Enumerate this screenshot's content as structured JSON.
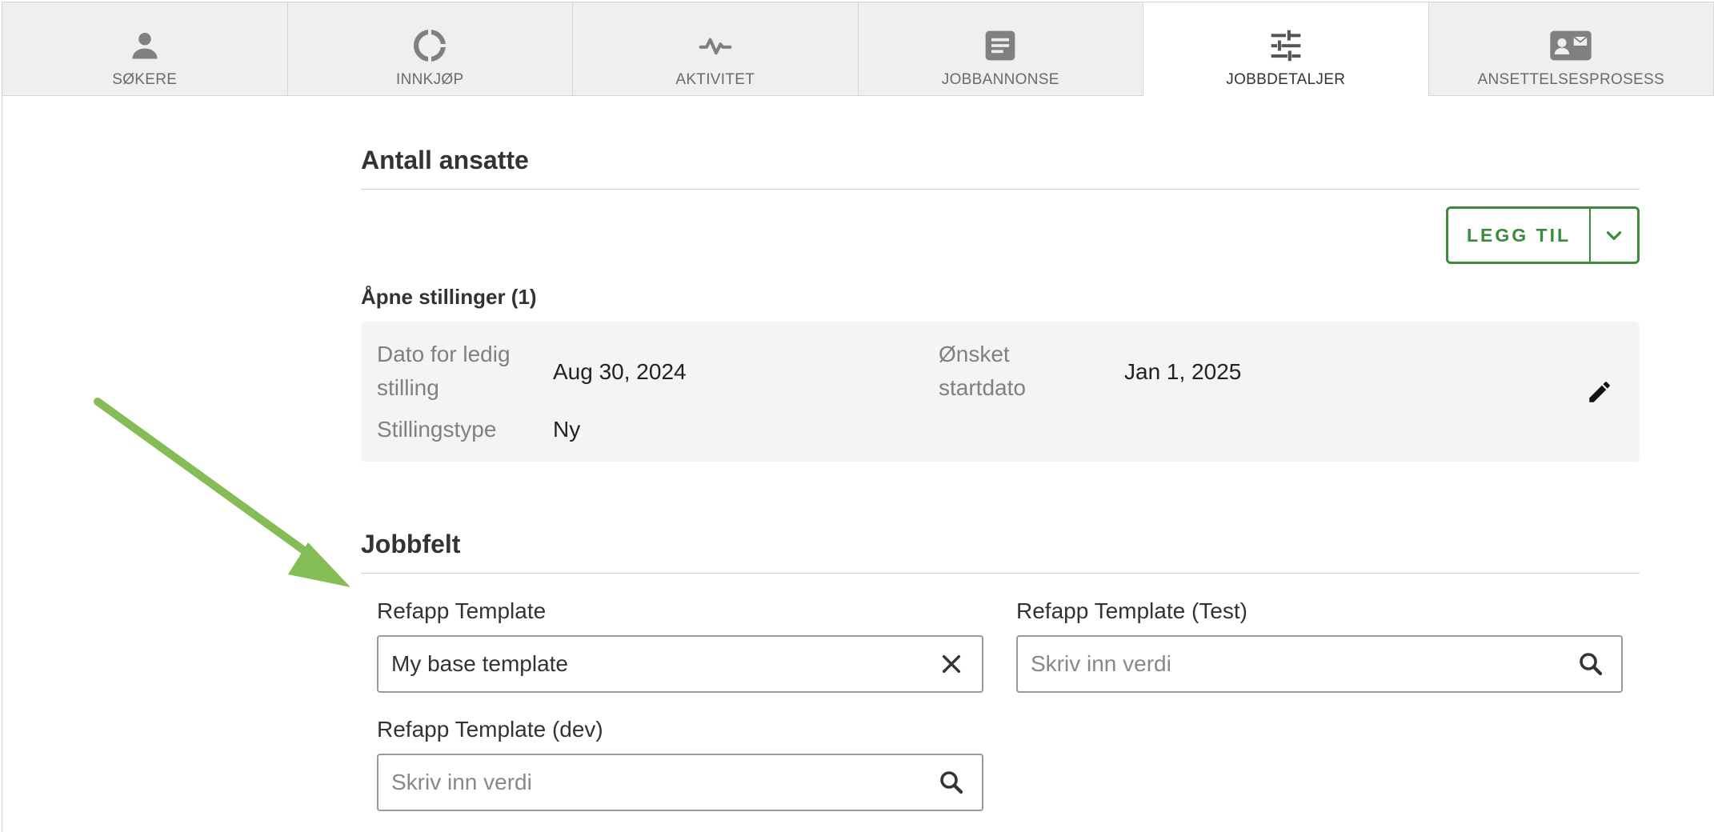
{
  "tabs": [
    {
      "label": "SØKERE",
      "icon": "person-icon"
    },
    {
      "label": "INNKJØP",
      "icon": "donut-icon"
    },
    {
      "label": "AKTIVITET",
      "icon": "activity-icon"
    },
    {
      "label": "JOBBANNONSE",
      "icon": "document-icon"
    },
    {
      "label": "JOBBDETALJER",
      "icon": "sliders-icon",
      "active": true
    },
    {
      "label": "ANSETTELSESPROSESS",
      "icon": "contact-card-icon"
    }
  ],
  "employees": {
    "title": "Antall ansatte",
    "add_button": "LEGG TIL",
    "open_positions_title": "Åpne stillinger (1)",
    "position": {
      "vacancy_date_label": "Dato for ledig stilling",
      "vacancy_date_value": "Aug 30, 2024",
      "start_date_label": "Ønsket startdato",
      "start_date_value": "Jan 1, 2025",
      "position_type_label": "Stillingstype",
      "position_type_value": "Ny"
    }
  },
  "job_fields": {
    "title": "Jobbfelt",
    "fields": [
      {
        "label": "Refapp Template",
        "value": "My base template",
        "placeholder": ""
      },
      {
        "label": "Refapp Template (Test)",
        "value": "",
        "placeholder": "Skriv inn verdi"
      },
      {
        "label": "Refapp Template (dev)",
        "value": "",
        "placeholder": "Skriv inn verdi"
      }
    ]
  },
  "colors": {
    "accent_green": "#3c8a3e",
    "annotation_arrow": "#84bd55",
    "tab_inactive_bg": "#efefef",
    "card_bg": "#f3f4f6"
  }
}
